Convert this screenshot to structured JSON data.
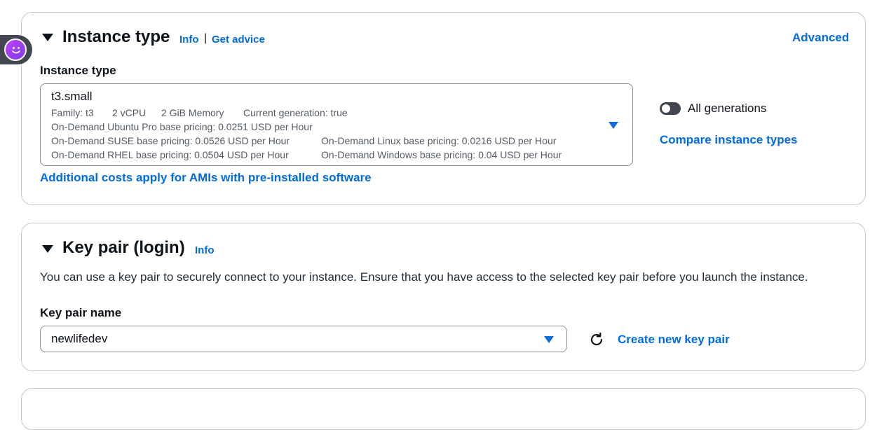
{
  "instance_section": {
    "title": "Instance type",
    "info": "Info",
    "separator": "|",
    "get_advice": "Get advice",
    "advanced": "Advanced",
    "field_label": "Instance type",
    "selected": {
      "name": "t3.small",
      "family": "Family: t3",
      "vcpu": "2 vCPU",
      "memory": "2 GiB Memory",
      "generation": "Current generation: true",
      "ubuntu_pro": "On-Demand Ubuntu Pro base pricing: 0.0251 USD per Hour",
      "suse": "On-Demand SUSE base pricing: 0.0526 USD per Hour",
      "linux": "On-Demand Linux base pricing: 0.0216 USD per Hour",
      "rhel": "On-Demand RHEL base pricing: 0.0504 USD per Hour",
      "windows": "On-Demand Windows base pricing: 0.04 USD per Hour"
    },
    "all_generations": "All generations",
    "all_generations_on": false,
    "compare": "Compare instance types",
    "additional_costs": "Additional costs apply for AMIs with pre-installed software"
  },
  "keypair_section": {
    "title": "Key pair (login)",
    "info": "Info",
    "description": "You can use a key pair to securely connect to your instance. Ensure that you have access to the selected key pair before you launch the instance.",
    "field_label": "Key pair name",
    "selected": "newlifedev",
    "create_new": "Create new key pair"
  },
  "colors": {
    "link": "#006ce0",
    "text": "#0f141a",
    "border": "#c6c6cd",
    "assistant_avatar": "#c341f5"
  },
  "icons": {
    "collapse": "caret-down-icon",
    "dropdown": "triangle-down-icon",
    "refresh": "refresh-icon",
    "assistant": "assistant-avatar-icon"
  }
}
